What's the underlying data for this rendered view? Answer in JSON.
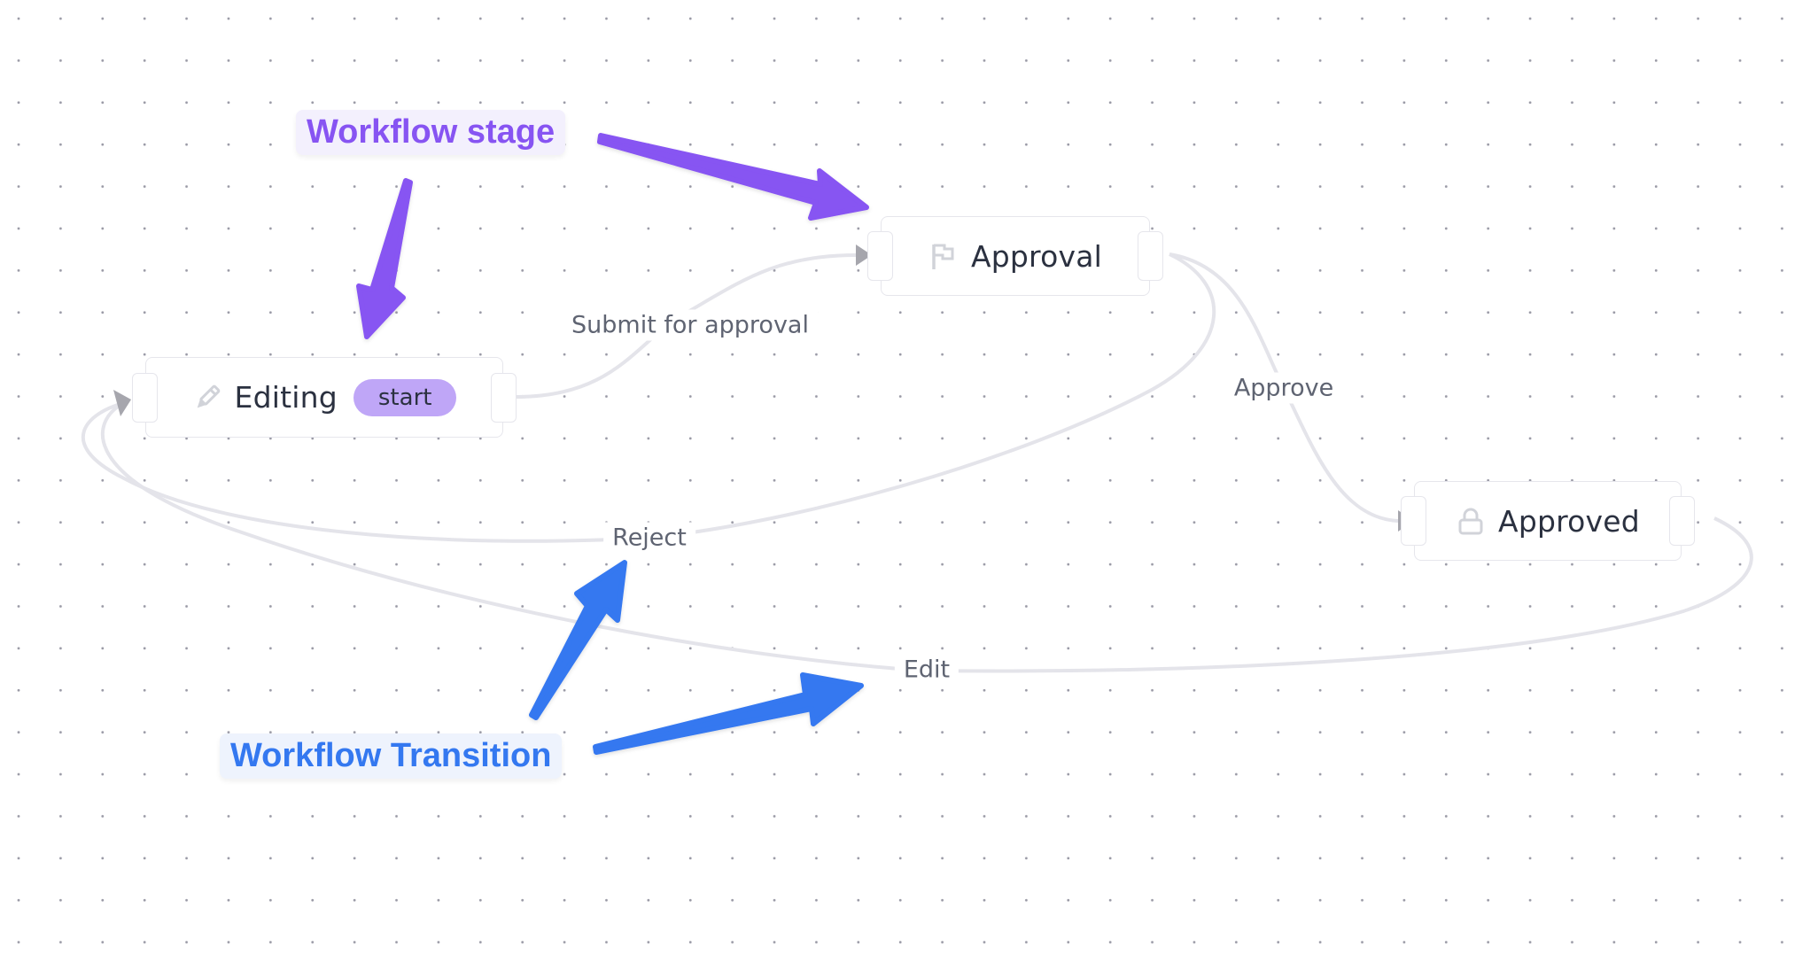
{
  "canvas": {
    "background": "dotted-grid"
  },
  "colors": {
    "stage_accent": "#8754f2",
    "transition_accent": "#3478f0",
    "start_badge": "#bfa6f7",
    "edge": "#e4e4ea",
    "edge_arrow": "#a6a6ad"
  },
  "nodes": [
    {
      "id": "editing",
      "label": "Editing",
      "icon": "pencil-icon",
      "badge": "start"
    },
    {
      "id": "approval",
      "label": "Approval",
      "icon": "flag-icon"
    },
    {
      "id": "approved",
      "label": "Approved",
      "icon": "lock-icon"
    }
  ],
  "edges": [
    {
      "label": "Submit for approval",
      "from": "Editing",
      "to": "Approval"
    },
    {
      "label": "Approve",
      "from": "Approval",
      "to": "Approved"
    },
    {
      "label": "Reject",
      "from": "Approval",
      "to": "Editing"
    },
    {
      "label": "Edit",
      "from": "Approved",
      "to": "Editing"
    }
  ],
  "annotations": {
    "stage": "Workflow stage",
    "transition": "Workflow Transition"
  }
}
